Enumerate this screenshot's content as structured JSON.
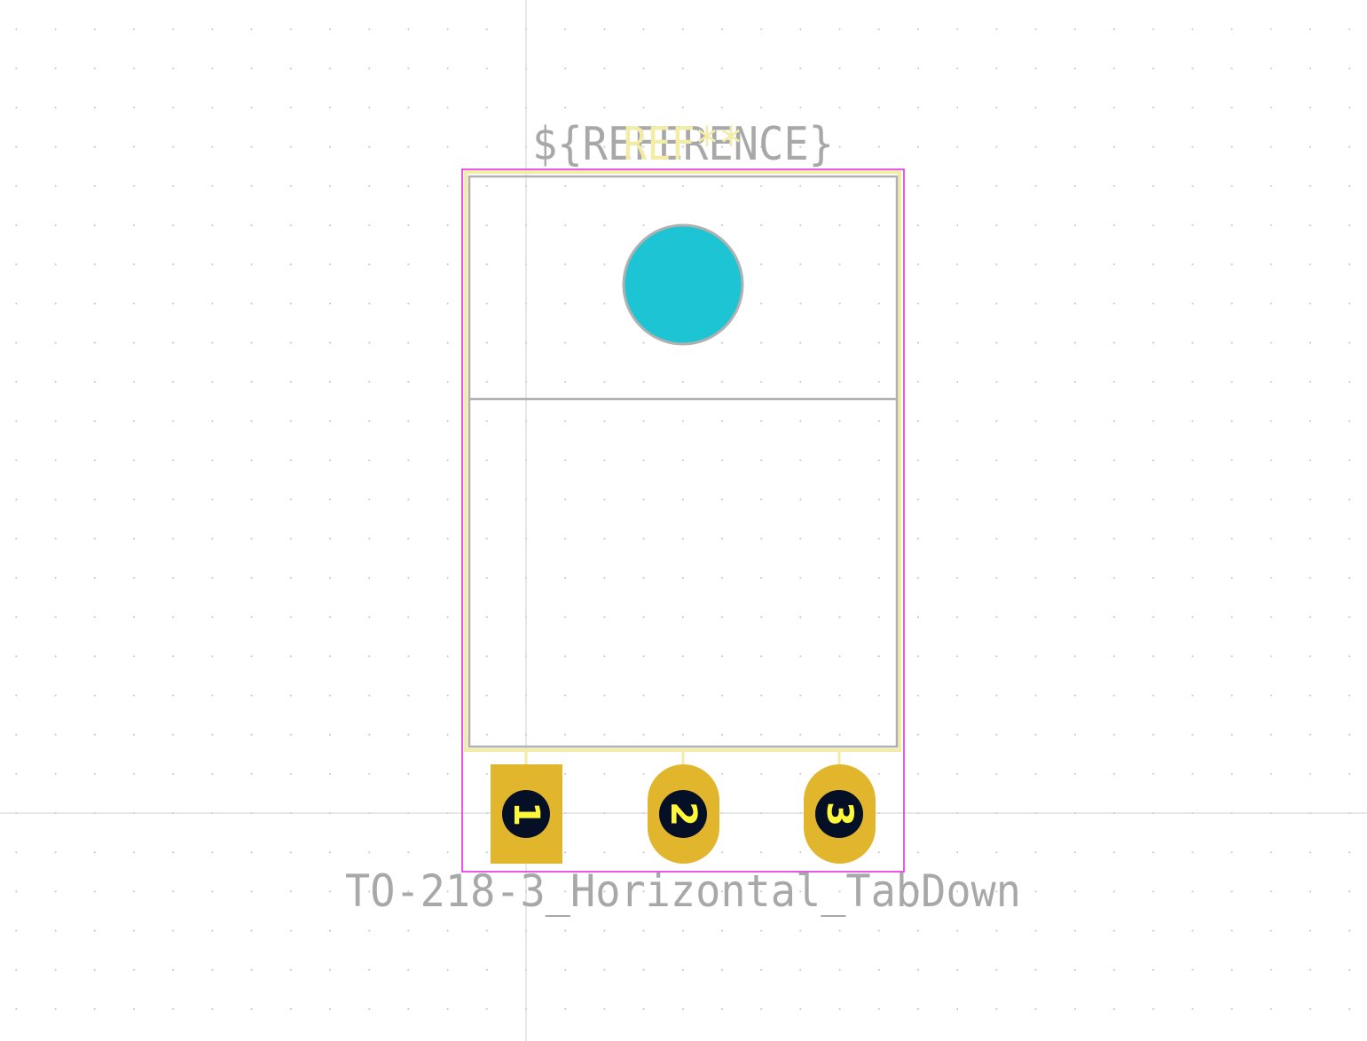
{
  "reference_text": "${REFERENCE}",
  "reference_overlay": "REF**",
  "footprint_value": "TO-218-3_Horizontal_TabDown",
  "pads": [
    {
      "number": "1",
      "shape": "rect"
    },
    {
      "number": "2",
      "shape": "oval"
    },
    {
      "number": "3",
      "shape": "oval"
    }
  ],
  "colors": {
    "background": "#ffffff",
    "courtyard": "#e62ee6",
    "silkscreen": "#f2eca6",
    "fabrication": "#b0b0b0",
    "pad_copper": "#e1b52c",
    "drill_hole": "#050f25",
    "mounting_hole": "#1cc4d4",
    "pad_number": "#fff83a"
  }
}
